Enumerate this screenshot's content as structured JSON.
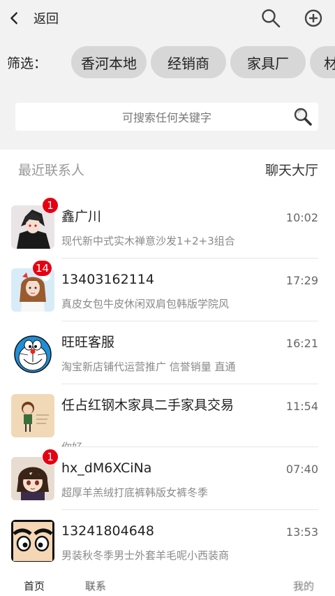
{
  "header": {
    "back_label": "返回",
    "back_icon": "chevron-left",
    "search_icon": "magnifier",
    "add_icon": "circle-plus"
  },
  "filter": {
    "label": "筛选：",
    "chips": [
      "香河本地",
      "经销商",
      "家具厂",
      "材"
    ]
  },
  "search": {
    "placeholder": "可搜索任何关键字"
  },
  "section": {
    "title": "最近联系人",
    "hall": "聊天大厅"
  },
  "chats": [
    {
      "name": "鑫广川",
      "time": "10:02",
      "msg": "现代新中式实木禅意沙发1+2+3组合",
      "badge": "1"
    },
    {
      "name": "13403162114",
      "time": "17:29",
      "msg": "真皮女包牛皮休闲双肩包韩版学院风",
      "badge": "14"
    },
    {
      "name": "旺旺客服",
      "time": "16:21",
      "msg": "淘宝新店铺代运营推广 信誉销量 直通",
      "badge": ""
    },
    {
      "name": "任占红钢木家具二手家具交易",
      "time": "11:54",
      "msg": "你好",
      "badge": ""
    },
    {
      "name": "hx_dM6XCiNa",
      "time": "07:40",
      "msg": "超厚羊羔绒打底裤韩版女裤冬季",
      "badge": "1"
    },
    {
      "name": "13241804648",
      "time": "13:53",
      "msg": "男装秋冬季男士外套羊毛呢小西装商",
      "badge": ""
    }
  ],
  "tabbar": {
    "home": "首页",
    "tab2": "联系",
    "tab3": "我的"
  },
  "colors": {
    "badge": "#e60012",
    "chip": "#d7d7d7",
    "background": "#f2f2f2"
  }
}
